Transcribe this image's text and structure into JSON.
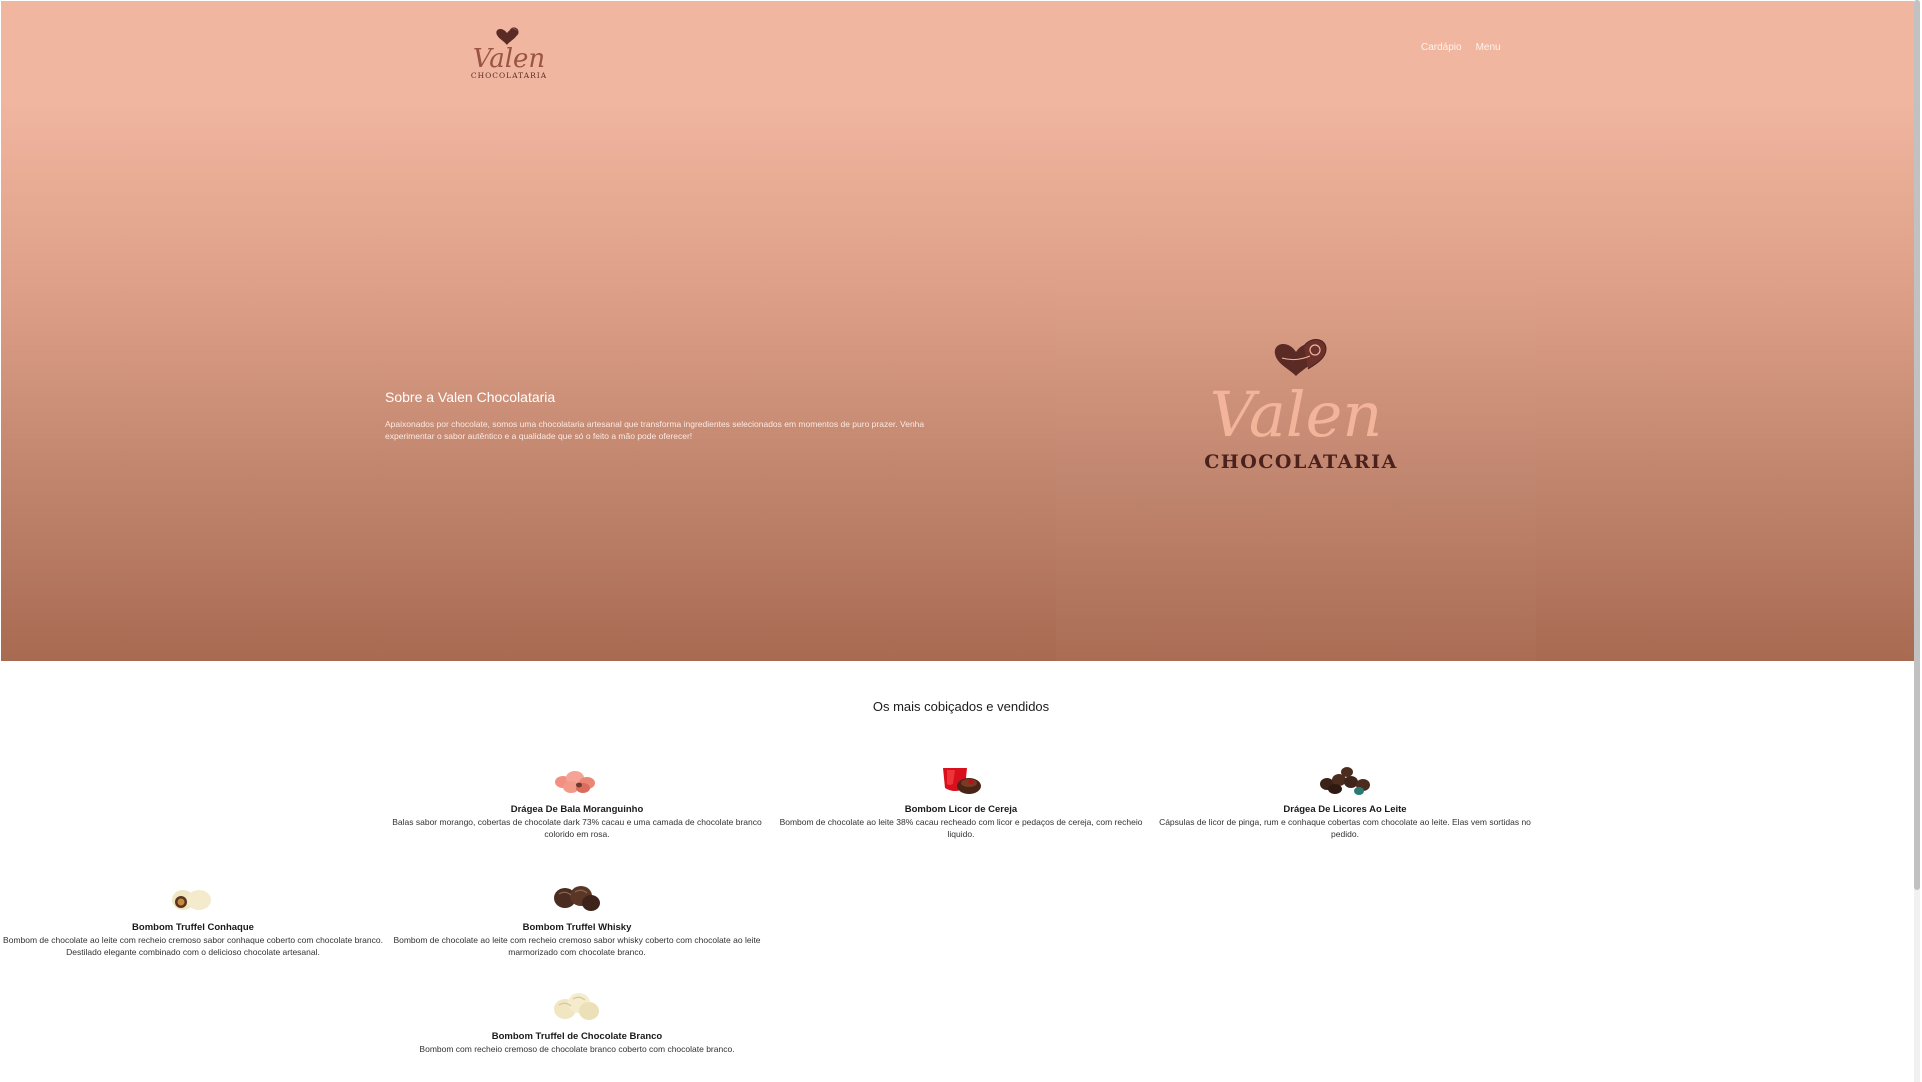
{
  "header": {
    "logo": {
      "word": "Valen",
      "subword": "CHOCOLATARIA"
    },
    "nav": [
      "Cardápio",
      "Menu"
    ]
  },
  "hero": {
    "about_title": "Sobre a Valen Chocolataria",
    "about_text": "Apaixonados por chocolate, somos uma chocolataria artesanal que transforma ingredientes selecionados em momentos de puro prazer. Venha experimentar o sabor autêntico e a qualidade que só o feito a mão pode oferecer!",
    "big_logo": {
      "word": "Valen",
      "subword": "CHOCOLATARIA"
    }
  },
  "section_title": "Os mais cobiçados e vendidos",
  "products": [
    {
      "name": "Drágea De Bala Moranguinho",
      "desc": "Balas sabor morango, cobertas de chocolate dark 73% cacau e uma camada de chocolate branco colorido em rosa.",
      "image": "pink-drageas"
    },
    {
      "name": "Bombom Licor de Cereja",
      "desc": "Bombom de chocolate ao leite 38% cacau recheado com licor e pedaços de cereja, com recheio liquido.",
      "image": "cherry-bonbon"
    },
    {
      "name": "Drágea De Licores Ao Leite",
      "desc": "Cápsulas de licor de pinga, rum e conhaque cobertas com chocolate ao leite. Elas vem sortidas no pedido.",
      "image": "liquor-drageas"
    },
    {
      "name": "Bombom Truffel Conhaque",
      "desc": "Bombom de chocolate ao leite com recheio cremoso sabor conhaque coberto com chocolate branco. Destilado elegante combinado com o delicioso chocolate artesanal.",
      "image": "white-truffle"
    },
    {
      "name": "Bombom Truffel Whisky",
      "desc": "Bombom de chocolate ao leite com recheio cremoso sabor whisky coberto com chocolate ao leite marmorizado com chocolate branco.",
      "image": "dark-truffle"
    },
    {
      "name": "Bombom Truffel de Chocolate Branco",
      "desc": "Bombom com recheio cremoso de chocolate branco coberto com chocolate branco.",
      "image": "white-truffles"
    }
  ],
  "colors": {
    "hero_top": "#f1b6a0",
    "hero_bottom": "#a86a51",
    "brand_dark": "#5a2a24",
    "brand_light": "#f3b49c"
  }
}
